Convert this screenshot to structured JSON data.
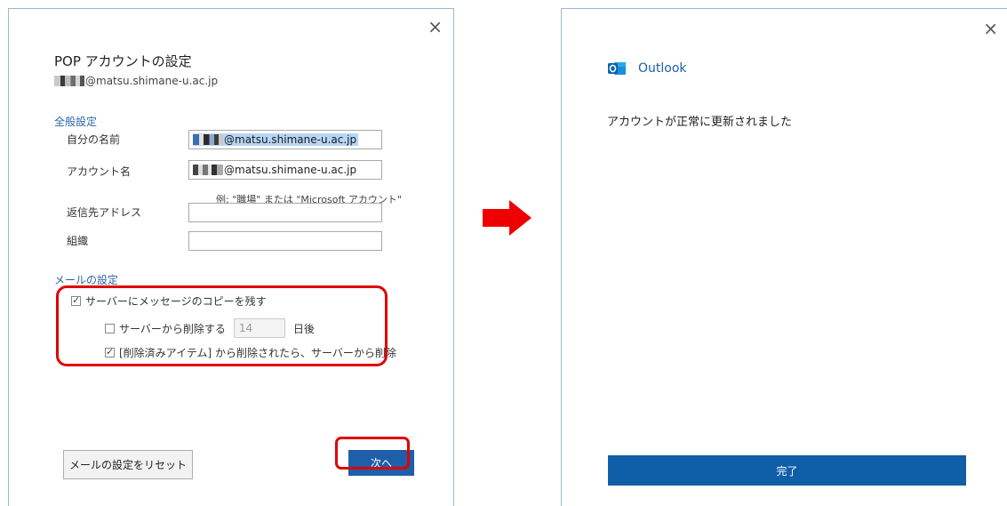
{
  "left_dialog": {
    "close_glyph": "×",
    "title": "POP アカウントの設定",
    "email": "@matsu.shimane-u.ac.jp",
    "general_section": "全般設定",
    "fields": {
      "your_name_label": "自分の名前",
      "your_name_value": "@matsu.shimane-u.ac.jp",
      "account_name_label": "アカウント名",
      "account_name_value": "@matsu.shimane-u.ac.jp",
      "account_hint": "例: \"職場\" または \"Microsoft アカウント\"",
      "reply_address_label": "返信先アドレス",
      "reply_address_value": "",
      "organization_label": "組織",
      "organization_value": ""
    },
    "mail_section": "メールの設定",
    "options": {
      "leave_copy_label": "サーバーにメッセージのコピーを残す",
      "leave_copy_checked": true,
      "delete_after_label": "サーバーから削除する",
      "delete_after_checked": false,
      "delete_after_days": "14",
      "delete_after_unit": "日後",
      "delete_when_removed_label": "[削除済みアイテム] から削除されたら、サーバーから削除",
      "delete_when_removed_checked": true
    },
    "buttons": {
      "reset": "メールの設定をリセット",
      "next": "次へ"
    }
  },
  "right_dialog": {
    "close_glyph": "×",
    "app_name": "Outlook",
    "message": "アカウントが正常に更新されました",
    "done_button": "完了"
  },
  "colors": {
    "accent_blue": "#1f5ea8",
    "section_blue": "#2b64a8",
    "highlight_red": "#e00000",
    "arrow_red": "#ee0000"
  }
}
